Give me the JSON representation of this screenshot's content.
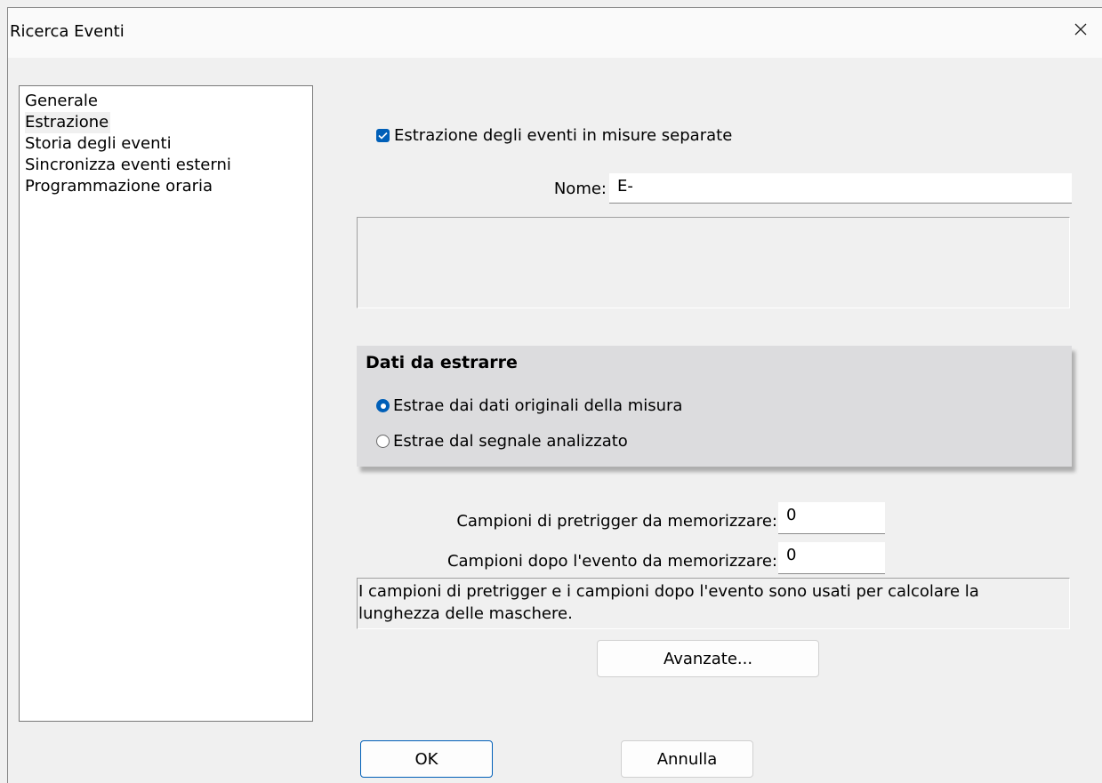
{
  "window": {
    "title": "Ricerca Eventi",
    "close_glyph": "✕"
  },
  "nav": {
    "items": [
      {
        "label": "Generale"
      },
      {
        "label": "Estrazione"
      },
      {
        "label": "Storia degli eventi"
      },
      {
        "label": "Sincronizza eventi esterni"
      },
      {
        "label": "Programmazione oraria"
      }
    ],
    "selected": "Estrazione"
  },
  "extraction": {
    "separate_label": "Estrazione degli eventi in misure separate",
    "separate_checked": true,
    "name_label": "Nome:",
    "name_value": "E-"
  },
  "data_group": {
    "title": "Dati da estrarre",
    "option_original": "Estrae dai dati originali della misura",
    "option_analyzed": "Estrae dal segnale analizzato",
    "selected": "Estrae dai dati originali della misura"
  },
  "samples": {
    "pretrigger_label": "Campioni di pretrigger da memorizzare:",
    "pretrigger_value": "0",
    "after_label": "Campioni dopo l'evento da memorizzare:",
    "after_value": "0",
    "info": "I campioni di pretrigger e i campioni dopo l'evento sono usati per calcolare la lunghezza delle maschere."
  },
  "buttons": {
    "advanced": "Avanzate...",
    "ok": "OK",
    "cancel": "Annulla"
  },
  "colors": {
    "accent": "#005fb8",
    "group_bg": "#dcdcde",
    "dialog_bg": "#f0f0f0"
  }
}
